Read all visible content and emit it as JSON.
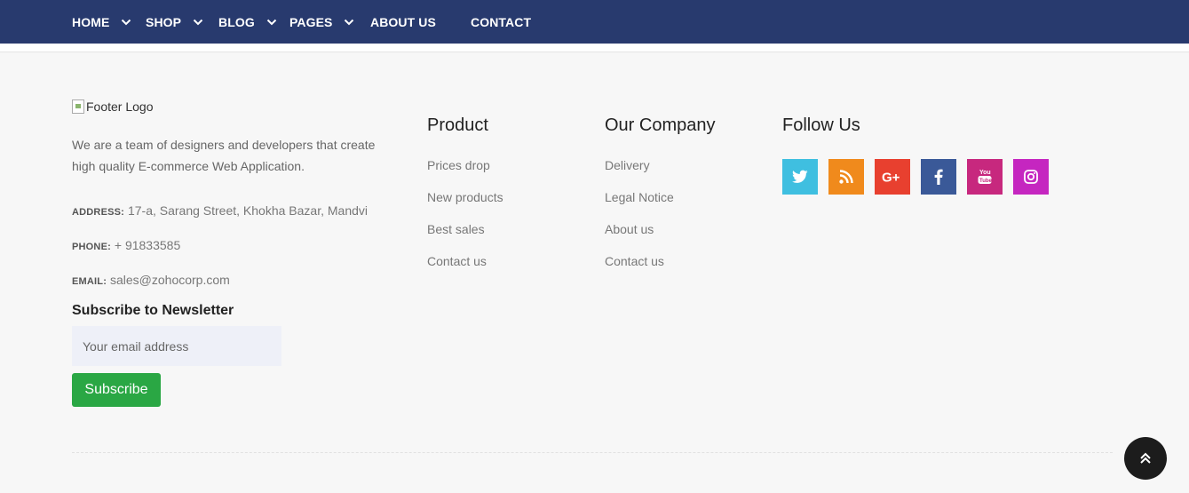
{
  "nav": {
    "items": [
      {
        "label": "HOME",
        "has_dropdown": true
      },
      {
        "label": "SHOP",
        "has_dropdown": true
      },
      {
        "label": "BLOG",
        "has_dropdown": true
      },
      {
        "label": "PAGES",
        "has_dropdown": true
      },
      {
        "label": "ABOUT US",
        "has_dropdown": false
      },
      {
        "label": "CONTACT",
        "has_dropdown": false
      }
    ],
    "bg_color": "#283a6e"
  },
  "footer": {
    "logo_alt": "Footer Logo",
    "about": "We are a team of designers and developers that create high quality E-commerce Web Application.",
    "address_label": "ADDRESS:",
    "address": "17-a, Sarang Street, Khokha Bazar, Mandvi",
    "phone_label": "PHONE:",
    "phone": "+ 91833585",
    "email_label": "EMAIL:",
    "email": "sales@zohocorp.com",
    "newsletter": {
      "title": "Subscribe to Newsletter",
      "placeholder": "Your email address",
      "button": "Subscribe",
      "button_color": "#2aa744"
    },
    "product": {
      "title": "Product",
      "links": [
        "Prices drop",
        "New products",
        "Best sales",
        "Contact us"
      ]
    },
    "company": {
      "title": "Our Company",
      "links": [
        "Delivery",
        "Legal Notice",
        "About us",
        "Contact us"
      ]
    },
    "follow": {
      "title": "Follow Us",
      "icons": [
        {
          "name": "twitter-icon",
          "color": "#3fbfe0"
        },
        {
          "name": "rss-icon",
          "color": "#f08a1c"
        },
        {
          "name": "google-plus-icon",
          "color": "#e8402f"
        },
        {
          "name": "facebook-icon",
          "color": "#3a5998"
        },
        {
          "name": "youtube-icon",
          "color": "#c7287e"
        },
        {
          "name": "instagram-icon",
          "color": "#c526c0"
        }
      ]
    }
  },
  "back_to_top": {
    "icon": "double-chevron-up-icon"
  }
}
